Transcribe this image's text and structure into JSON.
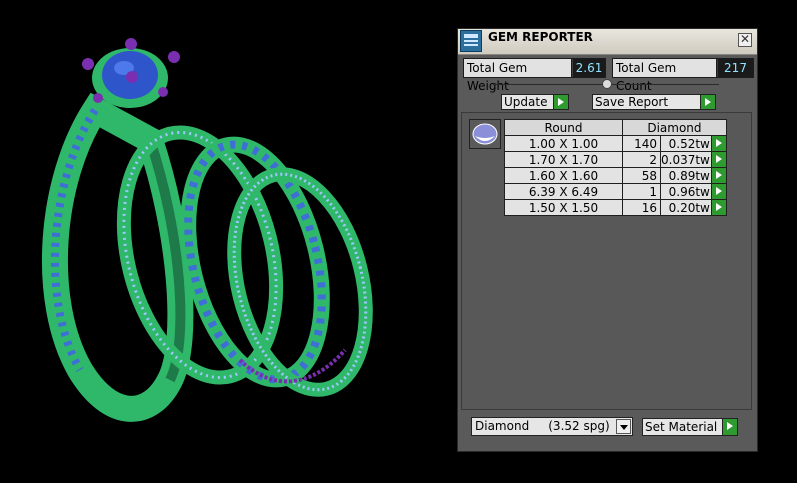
{
  "panel": {
    "title": "GEM REPORTER",
    "close_glyph": "✕",
    "icon": "gem-reporter-icon"
  },
  "stats": {
    "total_gem_weight_label": "Total Gem Weight",
    "total_gem_weight_value": "2.61",
    "total_gem_count_label": "Total Gem Count",
    "total_gem_count_value": "217"
  },
  "actions": {
    "update_label": "Update",
    "save_report_label": "Save Report"
  },
  "table": {
    "cut": "Round",
    "material": "Diamond",
    "rows": [
      {
        "size": "1.00 X 1.00",
        "count": "140",
        "weight": "0.52tw"
      },
      {
        "size": "1.70 X 1.70",
        "count": "2",
        "weight": "0.037tw"
      },
      {
        "size": "1.60 X 1.60",
        "count": "58",
        "weight": "0.89tw"
      },
      {
        "size": "6.39 X 6.49",
        "count": "1",
        "weight": "0.96tw"
      },
      {
        "size": "1.50 X 1.50",
        "count": "16",
        "weight": "0.20tw"
      }
    ]
  },
  "material_select": {
    "value": "Diamond     (3.52 spg)"
  },
  "set_material_label": "Set Material",
  "colors": {
    "ring_metal": "#2fb86a",
    "stones": "#3f6fd6",
    "prongs": "#7a2fb0",
    "accent_green": "#2f9a2f",
    "value_text": "#8fe3ff"
  }
}
